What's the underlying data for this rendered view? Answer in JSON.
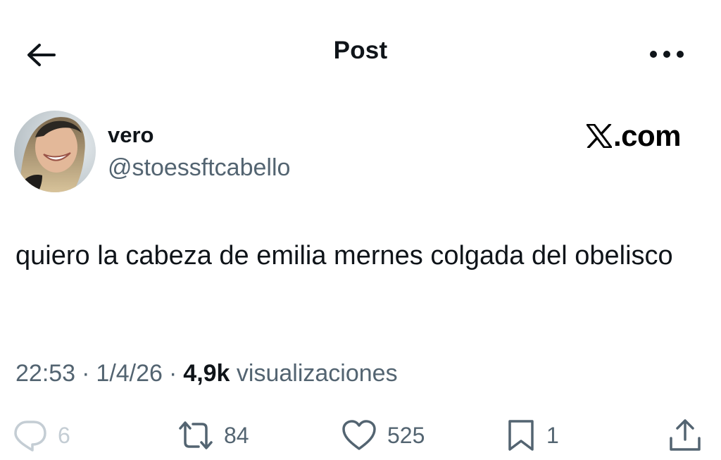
{
  "header": {
    "title": "Post",
    "back_icon": "arrow-left-icon",
    "more_icon": "more-horizontal-icon"
  },
  "author": {
    "display_name": "vero",
    "handle": "@stoessftcabello"
  },
  "watermark": {
    "text": ".com",
    "logo_icon": "x-logo-icon"
  },
  "tweet": {
    "text": "quiero la cabeza de emilia mernes colgada del obelisco",
    "time": "22:53",
    "separator": "·",
    "date": "1/4/26",
    "views_count": "4,9k",
    "views_label": "visualizaciones"
  },
  "actions": {
    "replies": "6",
    "reposts": "84",
    "likes": "525",
    "bookmarks": "1"
  },
  "colors": {
    "text_primary": "#0f1419",
    "text_secondary": "#536471",
    "faded": "#c4cdd4",
    "background": "#ffffff"
  }
}
